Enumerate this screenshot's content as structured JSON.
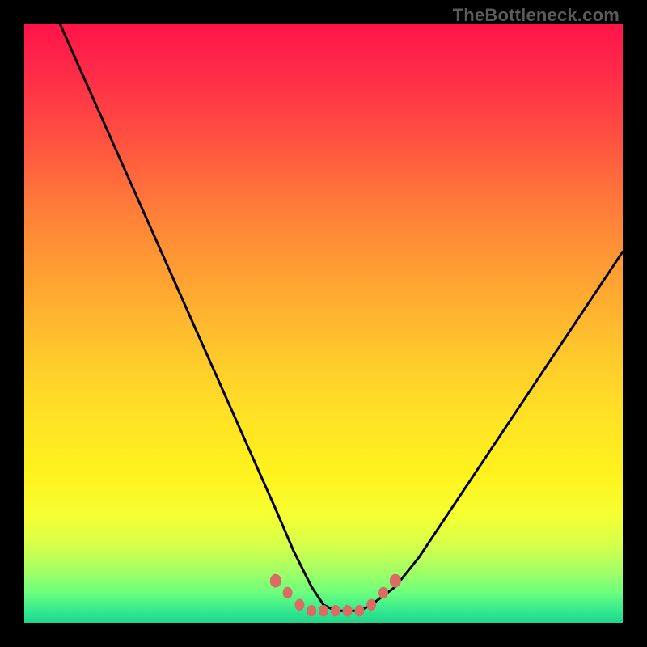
{
  "watermark": "TheBottleneck.com",
  "chart_data": {
    "type": "line",
    "title": "",
    "xlabel": "",
    "ylabel": "",
    "xlim": [
      0,
      100
    ],
    "ylim": [
      0,
      100
    ],
    "grid": false,
    "legend": false,
    "series": [
      {
        "name": "bottleneck-curve",
        "color": "#000000",
        "x": [
          6,
          10,
          14,
          18,
          22,
          26,
          30,
          34,
          38,
          42,
          45,
          48,
          50,
          52,
          54,
          56,
          58,
          62,
          66,
          70,
          74,
          78,
          82,
          86,
          90,
          94,
          98,
          100
        ],
        "y": [
          100,
          91,
          82,
          73,
          64,
          55,
          46,
          37,
          28,
          19,
          12,
          6,
          3,
          2,
          2,
          2,
          3,
          6,
          11,
          17,
          23,
          29,
          35,
          41,
          47,
          53,
          59,
          62
        ]
      }
    ],
    "markers": {
      "name": "valley-markers",
      "color": "#db6b63",
      "x": [
        42,
        44,
        46,
        48,
        50,
        52,
        54,
        56,
        58,
        60,
        62
      ],
      "y": [
        7,
        5,
        3,
        2,
        2,
        2,
        2,
        2,
        3,
        5,
        7
      ],
      "size": [
        14,
        12,
        12,
        12,
        12,
        12,
        12,
        12,
        12,
        12,
        14
      ]
    },
    "background_gradient": {
      "direction": "top-to-bottom",
      "stops": [
        {
          "pos": 0,
          "color": "#ff1449"
        },
        {
          "pos": 50,
          "color": "#ffc82c"
        },
        {
          "pos": 80,
          "color": "#fff21e"
        },
        {
          "pos": 100,
          "color": "#1fd68c"
        }
      ]
    }
  }
}
